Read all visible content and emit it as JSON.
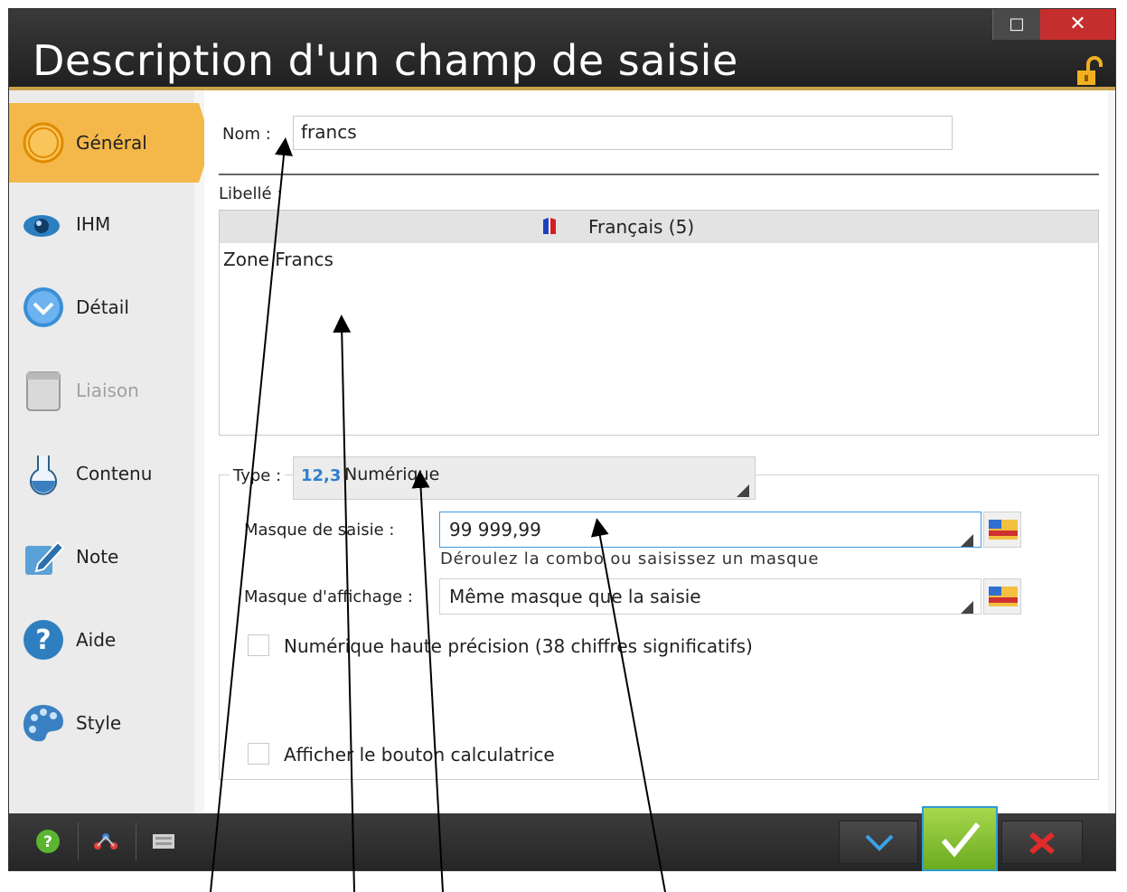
{
  "window": {
    "title": "Description d'un champ de saisie",
    "maximize_glyph": "□",
    "close_glyph": "✕"
  },
  "sidebar": {
    "items": [
      {
        "label": "Général",
        "icon": "circle-icon",
        "active": true
      },
      {
        "label": "IHM",
        "icon": "eye-icon"
      },
      {
        "label": "Détail",
        "icon": "chevron-circle-icon"
      },
      {
        "label": "Liaison",
        "icon": "window-icon",
        "disabled": true
      },
      {
        "label": "Contenu",
        "icon": "flask-icon"
      },
      {
        "label": "Note",
        "icon": "pencil-note-icon"
      },
      {
        "label": "Aide",
        "icon": "question-icon"
      },
      {
        "label": "Style",
        "icon": "palette-icon"
      }
    ]
  },
  "form": {
    "name_label": "Nom :",
    "name_value": "francs",
    "caption_label": "Libellé :",
    "language_header": "Français (5)",
    "caption_text": "Zone Francs",
    "type_label": "Type :",
    "type_icon_text": "12,3",
    "type_value": "Numérique",
    "input_mask_label": "Masque de saisie :",
    "input_mask_value": "99 999,99",
    "input_mask_help": "Déroulez la combo ou saisissez un masque",
    "display_mask_label": "Masque d'affichage :",
    "display_mask_value": "Même masque que la saisie",
    "high_precision_label": "Numérique haute précision (38 chiffres significatifs)",
    "calculator_label": "Afficher le bouton calculatrice"
  },
  "colors": {
    "accent": "#f4b84a",
    "ok_green": "#7dbf26",
    "cancel_red": "#e02b2b",
    "focus_blue": "#3d9be0"
  }
}
